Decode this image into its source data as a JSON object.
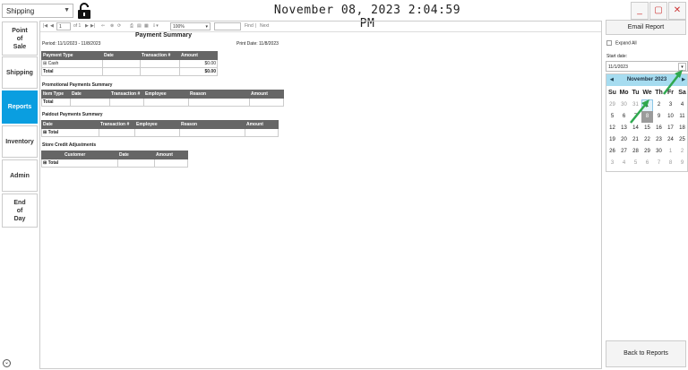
{
  "header": {
    "department_value": "Shipping",
    "clock": "November 08, 2023 2:04:59 PM",
    "minimize_label": "_",
    "restore_label": "▢",
    "close_label": "✕"
  },
  "sidebar": {
    "items": [
      {
        "label": "Point\nof\nSale"
      },
      {
        "label": "Shipping"
      },
      {
        "label": "Reports"
      },
      {
        "label": "Inventory"
      },
      {
        "label": "Admin"
      },
      {
        "label": "End\nof\nDay"
      }
    ]
  },
  "toolbar": {
    "page_current": "1",
    "page_total": "of 1",
    "zoom": "100%",
    "find_label": "Find",
    "next_label": "Next",
    "separator": "|"
  },
  "report": {
    "title": "Payment Summary",
    "period": "Period: 11/1/2023 - 11/8/2023",
    "print_date": "Print Date: 11/8/2023",
    "payment": {
      "headers": [
        "Payment Type",
        "Date",
        "Transaction #",
        "Amount"
      ],
      "rows": [
        {
          "type": "Cash",
          "amount": "$0.00",
          "expand": "⊞"
        },
        {
          "type": "Total",
          "amount": "$0.00"
        }
      ]
    },
    "promotional": {
      "title": "Promotional Payments Summary",
      "headers": [
        "Item Type",
        "Date",
        "Transaction #",
        "Employee",
        "Reason",
        "Amount"
      ],
      "total_label": "Total"
    },
    "paidout": {
      "title": "Paidout Payments Summary",
      "headers": [
        "Date",
        "Transaction #",
        "Employee",
        "Reason",
        "Amount"
      ],
      "total_label": "Total",
      "expand": "⊞"
    },
    "store_credit": {
      "title": "Store Credit Adjustments",
      "headers": [
        "",
        "Customer",
        "Date",
        "Amount"
      ],
      "total_label": "Total",
      "expand": "⊞"
    }
  },
  "right_panel": {
    "email_label": "Email Report",
    "expand_all_label": "Expand All",
    "start_date_label": "Start date:",
    "start_date_value": "11/1/2023",
    "back_label": "Back to Reports",
    "calendar": {
      "month_label": "November 2023",
      "dow": [
        "Su",
        "Mo",
        "Tu",
        "We",
        "Th",
        "Fr",
        "Sa"
      ],
      "weeks": [
        [
          "29",
          "30",
          "31",
          "1",
          "2",
          "3",
          "4"
        ],
        [
          "5",
          "6",
          "7",
          "8",
          "9",
          "10",
          "11"
        ],
        [
          "12",
          "13",
          "14",
          "15",
          "16",
          "17",
          "18"
        ],
        [
          "19",
          "20",
          "21",
          "22",
          "23",
          "24",
          "25"
        ],
        [
          "26",
          "27",
          "28",
          "29",
          "30",
          "1",
          "2"
        ],
        [
          "3",
          "4",
          "5",
          "6",
          "7",
          "8",
          "9"
        ]
      ]
    }
  },
  "colors": {
    "accent": "#0a9ee0",
    "calendar_header": "#a6dcf0",
    "arrow": "#2fa84f"
  }
}
